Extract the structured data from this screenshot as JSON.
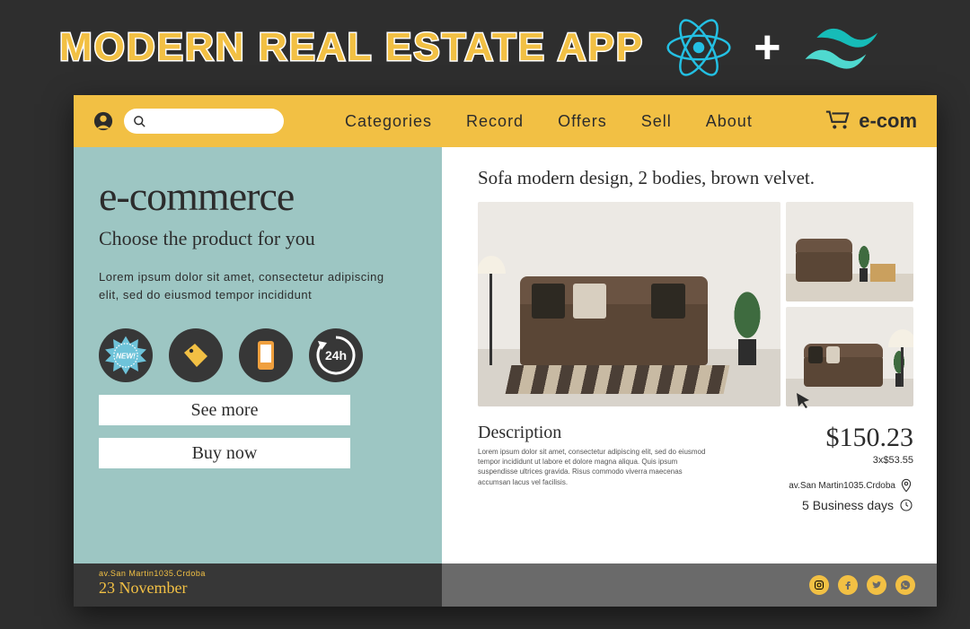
{
  "banner": {
    "title": "Modern Real Estate App",
    "plus": "+"
  },
  "nav": {
    "links": [
      "Categories",
      "Record",
      "Offers",
      "Sell",
      "About"
    ],
    "brand": "e-com"
  },
  "left": {
    "heading": "e-commerce",
    "sub": "Choose the product for you",
    "para": "Lorem ipsum dolor sit amet, consectetur adipiscing elit, sed do eiusmod tempor incididunt",
    "badge_new": "NEW!",
    "badge_24h": "24h",
    "btn_more": "See more",
    "btn_buy": "Buy now"
  },
  "right": {
    "title": "Sofa modern design, 2 bodies, brown velvet.",
    "desc_h": "Description",
    "desc_p": "Lorem ipsum dolor sit amet, consectetur adipiscing elit, sed do eiusmod tempor incididunt ut labore et dolore magna aliqua. Quis ipsum suspendisse ultrices gravida. Risus commodo viverra maecenas accumsan lacus vel facilisis.",
    "price": "$150.23",
    "price_sub": "3x$53.55",
    "address": "av.San Martin1035.Crdoba",
    "ship": "5 Business days"
  },
  "footer": {
    "addr": "av.San Martin1035.Crdoba",
    "date": "23 November"
  },
  "icons": {
    "user": "user-icon",
    "search": "search-icon",
    "cart": "cart-icon",
    "new": "new-badge-icon",
    "tag": "tag-icon",
    "phone": "phone-icon",
    "h24": "24h-icon",
    "pin": "map-pin-icon",
    "clock": "clock-icon",
    "ig": "instagram-icon",
    "fb": "facebook-icon",
    "tw": "twitter-icon",
    "wa": "whatsapp-icon",
    "react": "react-logo-icon",
    "tailwind": "tailwind-logo-icon",
    "cursor": "cursor-icon"
  }
}
